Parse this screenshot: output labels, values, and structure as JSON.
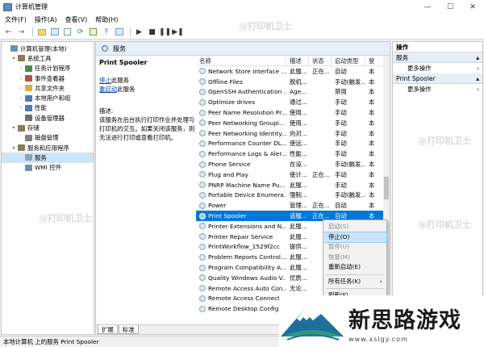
{
  "window": {
    "title": "计算机管理",
    "controls": [
      "—",
      "☐",
      "✕"
    ]
  },
  "menu": [
    "文件(F)",
    "操作(A)",
    "查看(V)",
    "帮助(H)"
  ],
  "tree": [
    {
      "label": "计算机管理(本地)",
      "indent": 0,
      "arrow": "",
      "color": "#6f8fb4"
    },
    {
      "label": "系统工具",
      "indent": 1,
      "arrow": "▾",
      "color": "#8a7a5a"
    },
    {
      "label": "任务计划程序",
      "indent": 2,
      "arrow": "›",
      "color": "#4c8a4c"
    },
    {
      "label": "事件查看器",
      "indent": 2,
      "arrow": "›",
      "color": "#b05050"
    },
    {
      "label": "共享文件夹",
      "indent": 2,
      "arrow": "›",
      "color": "#d8b040"
    },
    {
      "label": "本地用户和组",
      "indent": 2,
      "arrow": "›",
      "color": "#5078b0"
    },
    {
      "label": "性能",
      "indent": 2,
      "arrow": "›",
      "color": "#4080c0"
    },
    {
      "label": "设备管理器",
      "indent": 2,
      "arrow": "",
      "color": "#707070"
    },
    {
      "label": "存储",
      "indent": 1,
      "arrow": "▾",
      "color": "#8a7a5a"
    },
    {
      "label": "磁盘管理",
      "indent": 2,
      "arrow": "",
      "color": "#808080"
    },
    {
      "label": "服务和应用程序",
      "indent": 1,
      "arrow": "▾",
      "color": "#8a7a5a"
    },
    {
      "label": "服务",
      "indent": 2,
      "arrow": "",
      "color": "#8aa4c0",
      "selected": true
    },
    {
      "label": "WMI 控件",
      "indent": 2,
      "arrow": "",
      "color": "#7090b0"
    }
  ],
  "center": {
    "header": "服务",
    "selected_service": "Print Spooler",
    "stop_link": "停止",
    "stop_suffix": "此服务",
    "restart_link": "重启动",
    "restart_suffix": "此服务",
    "desc_heading": "描述:",
    "desc_text": "该服务在后台执行打印作业并处理与打印机的交互。如果关闭该服务，则无法进行打印或查看打印机。",
    "columns": [
      "名称",
      "描述",
      "状态",
      "启动类型",
      "登"
    ],
    "rows": [
      {
        "name": "Network Store Interface ...",
        "desc": "此服...",
        "status": "正在...",
        "start": "自动",
        "logon": "本"
      },
      {
        "name": "Offline Files",
        "desc": "脱机...",
        "status": "",
        "start": "手动(触发...",
        "logon": "本"
      },
      {
        "name": "OpenSSH Authentication ...",
        "desc": "Age...",
        "status": "",
        "start": "禁用",
        "logon": "本"
      },
      {
        "name": "Optimize drives",
        "desc": "通过...",
        "status": "",
        "start": "手动",
        "logon": "本"
      },
      {
        "name": "Peer Name Resolution Pr...",
        "desc": "使用...",
        "status": "",
        "start": "手动",
        "logon": "本"
      },
      {
        "name": "Peer Networking Groupi...",
        "desc": "使用...",
        "status": "",
        "start": "手动",
        "logon": "本"
      },
      {
        "name": "Peer Networking Identity...",
        "desc": "向对...",
        "status": "",
        "start": "手动",
        "logon": "本"
      },
      {
        "name": "Performance Counter DL...",
        "desc": "使远...",
        "status": "",
        "start": "手动",
        "logon": "本"
      },
      {
        "name": "Performance Logs & Aler...",
        "desc": "性能...",
        "status": "",
        "start": "手动",
        "logon": "本"
      },
      {
        "name": "Phone Service",
        "desc": "在设...",
        "status": "",
        "start": "手动(触发...",
        "logon": "本"
      },
      {
        "name": "Plug and Play",
        "desc": "使计...",
        "status": "正在...",
        "start": "手动",
        "logon": "本"
      },
      {
        "name": "PNRP Machine Name Pu...",
        "desc": "此服...",
        "status": "",
        "start": "手动",
        "logon": "本"
      },
      {
        "name": "Portable Device Enumera...",
        "desc": "强制...",
        "status": "",
        "start": "手动(触发...",
        "logon": "本"
      },
      {
        "name": "Power",
        "desc": "管理...",
        "status": "正在...",
        "start": "自动",
        "logon": "本"
      },
      {
        "name": "Print Spooler",
        "desc": "该服...",
        "status": "正在...",
        "start": "自动",
        "logon": "本",
        "selected": true
      },
      {
        "name": "Printer Extensions and N...",
        "desc": "此服...",
        "status": "",
        "start": "",
        "logon": ""
      },
      {
        "name": "Printer Repair Service",
        "desc": "此服...",
        "status": "",
        "start": "",
        "logon": ""
      },
      {
        "name": "PrintWorkflow_1529f2cc",
        "desc": "提供...",
        "status": "",
        "start": "",
        "logon": ""
      },
      {
        "name": "Problem Reports Control...",
        "desc": "此服...",
        "status": "",
        "start": "",
        "logon": ""
      },
      {
        "name": "Program Compatibility A...",
        "desc": "此服...",
        "status": "",
        "start": "",
        "logon": ""
      },
      {
        "name": "Quality Windows Audio V...",
        "desc": "优质...",
        "status": "",
        "start": "",
        "logon": ""
      },
      {
        "name": "Remote Access Auto Con...",
        "desc": "无论...",
        "status": "",
        "start": "",
        "logon": ""
      },
      {
        "name": "Remote Access Connecti...",
        "desc": "管理...",
        "status": "",
        "start": "",
        "logon": ""
      },
      {
        "name": "Remote Desktop Configu...",
        "desc": "远程...",
        "status": "",
        "start": "",
        "logon": ""
      }
    ],
    "tabs": [
      "扩展",
      "标准"
    ]
  },
  "actions": {
    "header": "操作",
    "sections": [
      {
        "title": "服务",
        "items": [
          "更多操作"
        ]
      },
      {
        "title": "Print Spooler",
        "items": [
          "更多操作"
        ]
      }
    ]
  },
  "context_menu": [
    {
      "label": "启动(S)",
      "disabled": true
    },
    {
      "label": "停止(O)",
      "highlight": true
    },
    {
      "label": "暂停(U)",
      "disabled": true
    },
    {
      "label": "恢复(M)",
      "disabled": true
    },
    {
      "label": "重新启动(E)"
    },
    {
      "sep": true
    },
    {
      "label": "所有任务(K)",
      "submenu": true
    },
    {
      "sep": true
    },
    {
      "label": "刷新(F)"
    }
  ],
  "status_bar": "本地计算机 上的服务 Print Spooler",
  "watermark": "@打印机卫士",
  "logo": {
    "brand": "新思路游戏",
    "url": "www.xslgy.com"
  }
}
